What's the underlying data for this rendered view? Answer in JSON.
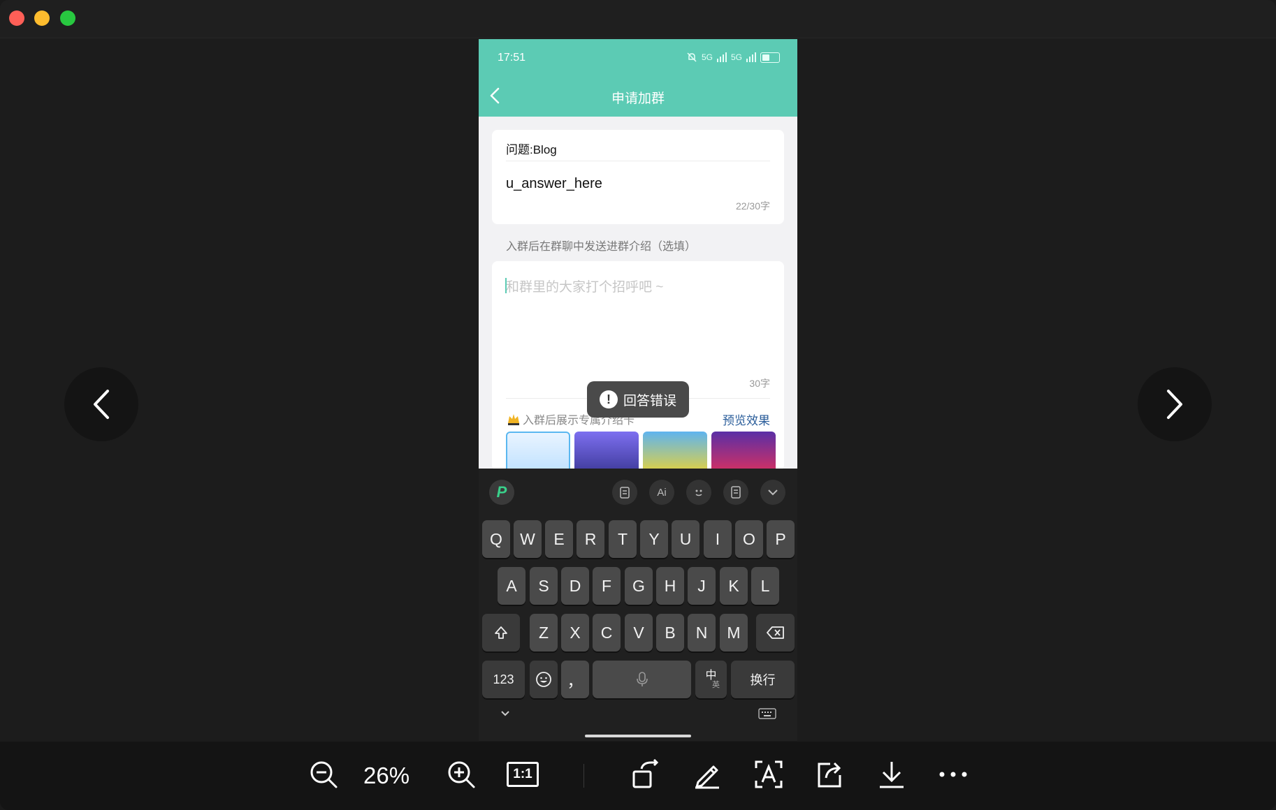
{
  "viewer": {
    "zoom": "26%",
    "actual_size_label": "1:1"
  },
  "phone": {
    "status": {
      "time": "17:51",
      "signal1": "5G",
      "signal2": "5G"
    },
    "header": {
      "title": "申请加群"
    },
    "question": {
      "label": "问题:Blog",
      "answer": "u_answer_here",
      "counter": "22/30字"
    },
    "intro_hint": "入群后在群聊中发送进群介绍（选填）",
    "intro": {
      "placeholder": "和群里的大家打个招呼吧 ~",
      "counter": "30字",
      "card_hint": "入群后展示专属介绍卡",
      "preview_link": "预览效果"
    },
    "thumbnails": [
      {
        "color_top": "#e9f4ff",
        "color_bottom": "#bfe1ff",
        "border": "#5ab7f0"
      },
      {
        "color_top": "#7d6ff0",
        "color_bottom": "#3e3a9a",
        "border": "none"
      },
      {
        "color_top": "#5fb4ef",
        "color_bottom": "#e5d23d",
        "border": "none"
      },
      {
        "color_top": "#5a2fa6",
        "color_bottom": "#d83060",
        "border": "none"
      }
    ],
    "toast": {
      "text": "回答错误"
    },
    "keyboard": {
      "row1": [
        "Q",
        "W",
        "E",
        "R",
        "T",
        "Y",
        "U",
        "I",
        "O",
        "P"
      ],
      "row2": [
        "A",
        "S",
        "D",
        "F",
        "G",
        "H",
        "J",
        "K",
        "L"
      ],
      "row3": [
        "Z",
        "X",
        "C",
        "V",
        "B",
        "N",
        "M"
      ],
      "num_key": "123",
      "punct_key": "，",
      "lang_key_main": "中",
      "lang_key_sub": "英",
      "enter_key": "换行"
    },
    "colors": {
      "accent": "#5ccbb4",
      "link": "#2a5d9a"
    }
  }
}
